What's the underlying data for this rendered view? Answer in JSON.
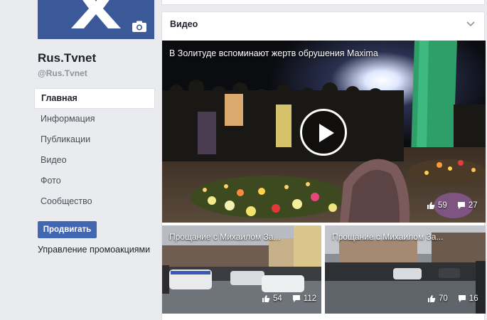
{
  "page": {
    "name": "Rus.Tvnet",
    "handle": "@Rus.Tvnet"
  },
  "nav": {
    "items": [
      {
        "label": "Главная",
        "active": true
      },
      {
        "label": "Информация"
      },
      {
        "label": "Публикации"
      },
      {
        "label": "Видео"
      },
      {
        "label": "Фото"
      },
      {
        "label": "Сообщество"
      }
    ]
  },
  "actions": {
    "promote_label": "Продвигать",
    "manage_promotions_label": "Управление промоакциями"
  },
  "videos_section": {
    "title": "Видео",
    "main_video": {
      "title": "В Золитуде вспоминают жертв обрушения Maxima",
      "likes": "59",
      "comments": "27"
    },
    "thumbs": [
      {
        "title": "Прощание с Михаилом За...",
        "likes": "54",
        "comments": "112"
      },
      {
        "title": "Прощание с Михаилом За...",
        "likes": "70",
        "comments": "16"
      }
    ]
  },
  "colors": {
    "brand": "#3b5998",
    "button": "#4267b2",
    "background": "#e9ebee"
  },
  "icons": {
    "camera": "camera-icon",
    "chevron": "chevron-down-icon",
    "play": "play-icon",
    "like": "like-icon",
    "comment": "comment-icon"
  }
}
